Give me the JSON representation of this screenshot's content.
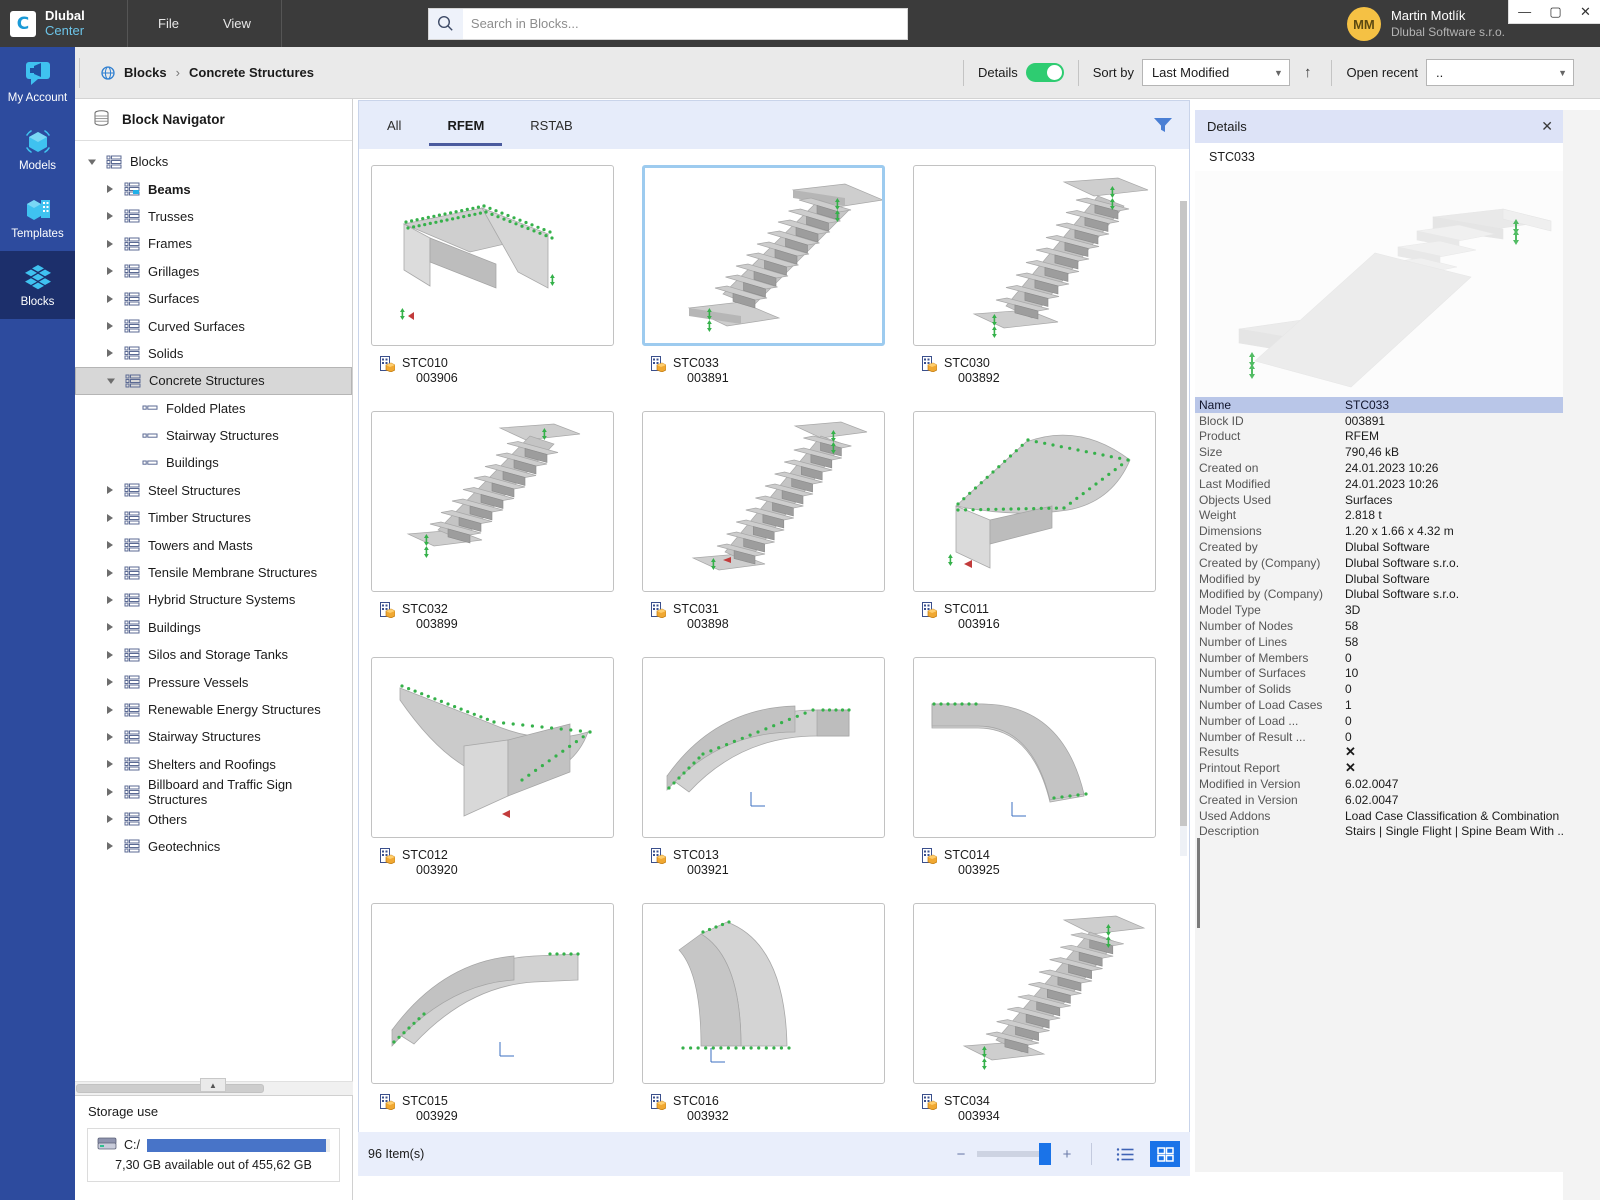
{
  "window": {
    "brand_line1": "Dlubal",
    "brand_line2": "Center",
    "brand_mark": "C",
    "minimize": "—",
    "maximize": "▢",
    "close": "✕"
  },
  "menu": {
    "items": [
      {
        "label": "File"
      },
      {
        "label": "View"
      }
    ]
  },
  "search": {
    "placeholder": "Search in Blocks...",
    "value": "",
    "icon": "search-icon"
  },
  "user": {
    "initials": "MM",
    "name": "Martin Motlík",
    "company": "Dlubal Software s.r.o."
  },
  "rail": {
    "items": [
      {
        "label": "My Account",
        "icon": "account-speech-icon",
        "active": false
      },
      {
        "label": "Models",
        "icon": "cube-models-icon",
        "active": false
      },
      {
        "label": "Templates",
        "icon": "templates-icon",
        "active": false
      },
      {
        "label": "Blocks",
        "icon": "blocks-cube-icon",
        "active": true
      }
    ]
  },
  "toolbar": {
    "breadcrumb": {
      "root_icon": "blocks-globe-icon",
      "root": "Blocks",
      "separator": "›",
      "current": "Concrete Structures"
    },
    "details_label": "Details",
    "details_on": true,
    "sort_label": "Sort by",
    "sort_value": "Last Modified",
    "sort_direction_icon": "arrow-up-icon",
    "open_recent_label": "Open recent",
    "open_recent_value": ".."
  },
  "navigator": {
    "title": "Block Navigator",
    "tree": [
      {
        "label": "Blocks",
        "depth": 0,
        "twisty": "down",
        "icon": "blocks-icon",
        "bold": false,
        "selected": false
      },
      {
        "label": "Beams",
        "depth": 1,
        "twisty": "right",
        "icon": "blocks-icon",
        "bold": true,
        "selected": false
      },
      {
        "label": "Trusses",
        "depth": 1,
        "twisty": "right",
        "icon": "blocks-icon",
        "bold": false,
        "selected": false
      },
      {
        "label": "Frames",
        "depth": 1,
        "twisty": "right",
        "icon": "blocks-icon",
        "bold": false,
        "selected": false
      },
      {
        "label": "Grillages",
        "depth": 1,
        "twisty": "right",
        "icon": "blocks-icon",
        "bold": false,
        "selected": false
      },
      {
        "label": "Surfaces",
        "depth": 1,
        "twisty": "right",
        "icon": "blocks-icon",
        "bold": false,
        "selected": false
      },
      {
        "label": "Curved Surfaces",
        "depth": 1,
        "twisty": "right",
        "icon": "blocks-icon",
        "bold": false,
        "selected": false
      },
      {
        "label": "Solids",
        "depth": 1,
        "twisty": "right",
        "icon": "blocks-icon",
        "bold": false,
        "selected": false
      },
      {
        "label": "Concrete Structures",
        "depth": 1,
        "twisty": "down",
        "icon": "blocks-icon",
        "bold": false,
        "selected": true
      },
      {
        "label": "Folded Plates",
        "depth": 2,
        "twisty": "none",
        "icon": "leaf-icon",
        "bold": false,
        "selected": false
      },
      {
        "label": "Stairway Structures",
        "depth": 2,
        "twisty": "none",
        "icon": "leaf-icon",
        "bold": false,
        "selected": false
      },
      {
        "label": "Buildings",
        "depth": 2,
        "twisty": "none",
        "icon": "leaf-icon",
        "bold": false,
        "selected": false
      },
      {
        "label": "Steel Structures",
        "depth": 1,
        "twisty": "right",
        "icon": "blocks-icon",
        "bold": false,
        "selected": false
      },
      {
        "label": "Timber Structures",
        "depth": 1,
        "twisty": "right",
        "icon": "blocks-icon",
        "bold": false,
        "selected": false
      },
      {
        "label": "Towers and Masts",
        "depth": 1,
        "twisty": "right",
        "icon": "blocks-icon",
        "bold": false,
        "selected": false
      },
      {
        "label": "Tensile Membrane Structures",
        "depth": 1,
        "twisty": "right",
        "icon": "blocks-icon",
        "bold": false,
        "selected": false
      },
      {
        "label": "Hybrid Structure Systems",
        "depth": 1,
        "twisty": "right",
        "icon": "blocks-icon",
        "bold": false,
        "selected": false
      },
      {
        "label": "Buildings",
        "depth": 1,
        "twisty": "right",
        "icon": "blocks-icon",
        "bold": false,
        "selected": false
      },
      {
        "label": "Silos and Storage Tanks",
        "depth": 1,
        "twisty": "right",
        "icon": "blocks-icon",
        "bold": false,
        "selected": false
      },
      {
        "label": "Pressure Vessels",
        "depth": 1,
        "twisty": "right",
        "icon": "blocks-icon",
        "bold": false,
        "selected": false
      },
      {
        "label": "Renewable Energy Structures",
        "depth": 1,
        "twisty": "right",
        "icon": "blocks-icon",
        "bold": false,
        "selected": false
      },
      {
        "label": "Stairway Structures",
        "depth": 1,
        "twisty": "right",
        "icon": "blocks-icon",
        "bold": false,
        "selected": false
      },
      {
        "label": "Shelters and Roofings",
        "depth": 1,
        "twisty": "right",
        "icon": "blocks-icon",
        "bold": false,
        "selected": false
      },
      {
        "label": "Billboard and Traffic Sign Structures",
        "depth": 1,
        "twisty": "right",
        "icon": "blocks-icon",
        "bold": false,
        "selected": false
      },
      {
        "label": "Others",
        "depth": 1,
        "twisty": "right",
        "icon": "blocks-icon",
        "bold": false,
        "selected": false
      },
      {
        "label": "Geotechnics",
        "depth": 1,
        "twisty": "right",
        "icon": "blocks-icon",
        "bold": false,
        "selected": false
      }
    ]
  },
  "storage": {
    "title": "Storage use",
    "drive": "C:/",
    "percent": 98,
    "caption": "7,30 GB available out of 455,62 GB",
    "bar_color": "#4874c8"
  },
  "content": {
    "tabs": [
      {
        "label": "All",
        "active": false
      },
      {
        "label": "RFEM",
        "active": true
      },
      {
        "label": "RSTAB",
        "active": false
      }
    ],
    "filter_icon": "filter-funnel-icon",
    "cards": [
      {
        "name": "STC010",
        "id": "003906",
        "selected": false,
        "thumb": "stair-folded-landing"
      },
      {
        "name": "STC033",
        "id": "003891",
        "selected": true,
        "thumb": "stair-straight-flight"
      },
      {
        "name": "STC030",
        "id": "003892",
        "selected": false,
        "thumb": "stair-spine-steps"
      },
      {
        "name": "STC032",
        "id": "003899",
        "selected": false,
        "thumb": "stair-steps-angled"
      },
      {
        "name": "STC031",
        "id": "003898",
        "selected": false,
        "thumb": "stair-long-flight"
      },
      {
        "name": "STC011",
        "id": "003916",
        "selected": false,
        "thumb": "curved-landing-plate"
      },
      {
        "name": "STC012",
        "id": "003920",
        "selected": false,
        "thumb": "curved-fan-plate"
      },
      {
        "name": "STC013",
        "id": "003921",
        "selected": false,
        "thumb": "curved-slab-ramp"
      },
      {
        "name": "STC014",
        "id": "003925",
        "selected": false,
        "thumb": "curved-arc-slab"
      },
      {
        "name": "STC015",
        "id": "003929",
        "selected": false,
        "thumb": "inclined-slab-ramp"
      },
      {
        "name": "STC016",
        "id": "003932",
        "selected": false,
        "thumb": "curved-wall-shell"
      },
      {
        "name": "STC034",
        "id": "003934",
        "selected": false,
        "thumb": "stair-steps-wide"
      }
    ]
  },
  "status": {
    "item_count": "96 Item(s)",
    "zoom_minus": "−",
    "zoom_plus": "+",
    "zoom_percent": 84,
    "list_view_icon": "list-view-icon",
    "grid_view_icon": "grid-view-icon",
    "active_view": "grid"
  },
  "details": {
    "title": "Details",
    "close_icon": "close-icon",
    "selected_name": "STC033",
    "preview_icon": "stair-3d-preview",
    "rows": [
      {
        "key": "Name",
        "value": "STC033",
        "highlight": true
      },
      {
        "key": "Block ID",
        "value": "003891",
        "highlight": false
      },
      {
        "key": "Product",
        "value": "RFEM",
        "highlight": false
      },
      {
        "key": "Size",
        "value": "790,46 kB",
        "highlight": false
      },
      {
        "key": "Created on",
        "value": "24.01.2023 10:26",
        "highlight": false
      },
      {
        "key": "Last Modified",
        "value": "24.01.2023 10:26",
        "highlight": false
      },
      {
        "key": "Objects Used",
        "value": "Surfaces",
        "highlight": false
      },
      {
        "key": "Weight",
        "value": "2.818 t",
        "highlight": false
      },
      {
        "key": "Dimensions",
        "value": "1.20 x 1.66 x 4.32 m",
        "highlight": false
      },
      {
        "key": "Created by",
        "value": "Dlubal Software",
        "highlight": false
      },
      {
        "key": "Created by (Company)",
        "value": "Dlubal Software s.r.o.",
        "highlight": false
      },
      {
        "key": "Modified by",
        "value": "Dlubal Software",
        "highlight": false
      },
      {
        "key": "Modified by (Company)",
        "value": "Dlubal Software s.r.o.",
        "highlight": false
      },
      {
        "key": "Model Type",
        "value": "3D",
        "highlight": false
      },
      {
        "key": "Number of Nodes",
        "value": "58",
        "highlight": false
      },
      {
        "key": "Number of Lines",
        "value": "58",
        "highlight": false
      },
      {
        "key": "Number of Members",
        "value": "0",
        "highlight": false
      },
      {
        "key": "Number of Surfaces",
        "value": "10",
        "highlight": false
      },
      {
        "key": "Number of Solids",
        "value": "0",
        "highlight": false
      },
      {
        "key": "Number of Load Cases",
        "value": "1",
        "highlight": false
      },
      {
        "key": "Number of Load ...",
        "value": "0",
        "highlight": false
      },
      {
        "key": "Number of Result ...",
        "value": "0",
        "highlight": false
      },
      {
        "key": "Results",
        "value": "✕",
        "highlight": false,
        "is_mark": true
      },
      {
        "key": "Printout Report",
        "value": "✕",
        "highlight": false,
        "is_mark": true
      },
      {
        "key": "Modified in Version",
        "value": "6.02.0047",
        "highlight": false
      },
      {
        "key": "Created in Version",
        "value": "6.02.0047",
        "highlight": false
      },
      {
        "key": "Used Addons",
        "value": "Load Case Classification & Combination ...",
        "highlight": false
      },
      {
        "key": "Description",
        "value": "Stairs | Single Flight | Spine Beam With ...",
        "highlight": false
      }
    ]
  }
}
